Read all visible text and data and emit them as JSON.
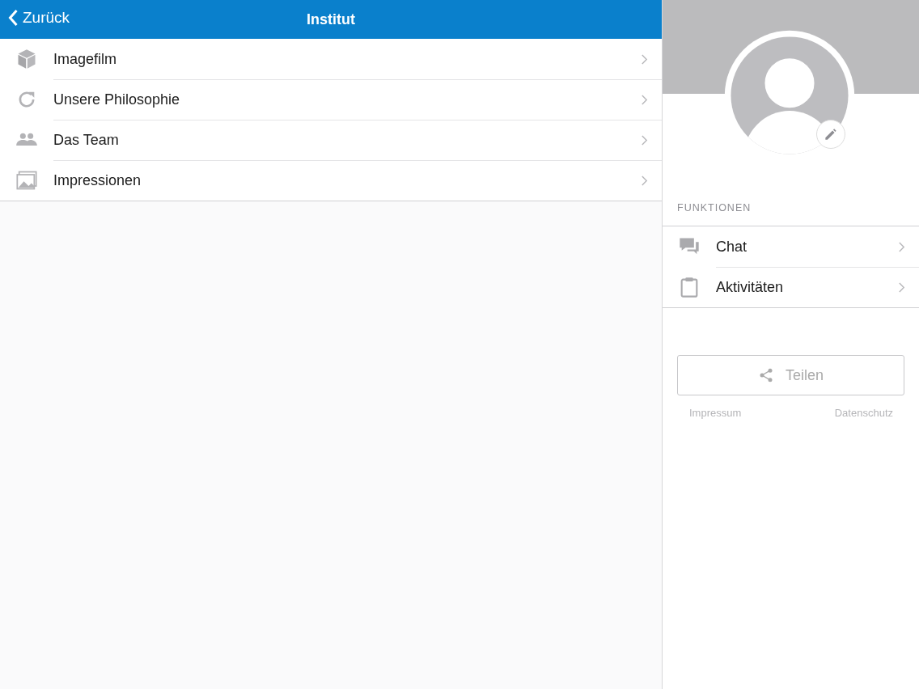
{
  "nav_bar": {
    "back": "Zurück",
    "title": "Institut"
  },
  "menu": [
    {
      "kind": "cube",
      "label": "Imagefilm"
    },
    {
      "kind": "refresh",
      "label": "Unsere Philosophie"
    },
    {
      "kind": "people",
      "label": "Das Team"
    },
    {
      "kind": "images",
      "label": "Impressionen"
    }
  ],
  "profile": {
    "section_title": "FUNKTIONEN",
    "functions": [
      {
        "kind": "chat",
        "label": "Chat"
      },
      {
        "kind": "clipboard",
        "label": "Aktivitäten"
      }
    ],
    "share_button": "Teilen",
    "links": [
      "Impressum",
      "Datenschutz"
    ]
  }
}
